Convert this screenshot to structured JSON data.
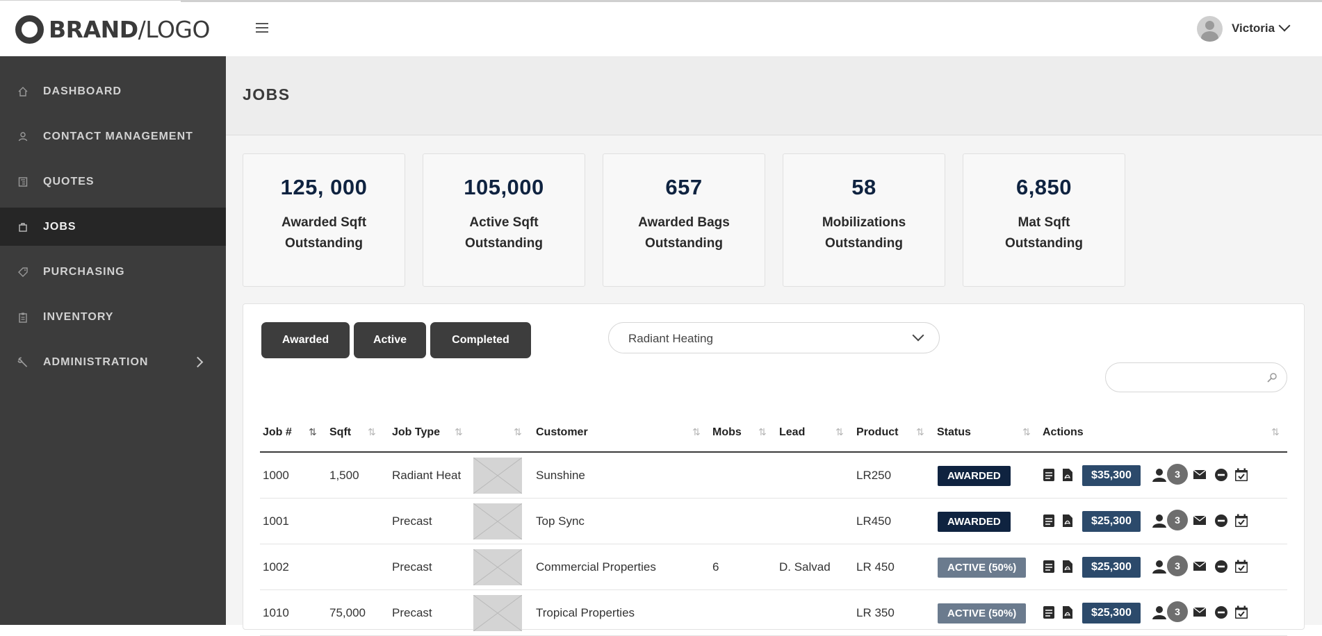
{
  "header": {
    "logo_bold": "BRAND",
    "logo_light": "/LOGO",
    "user_name": "Victoria"
  },
  "sidebar": {
    "items": [
      {
        "label": "DASHBOARD",
        "icon": "home-icon"
      },
      {
        "label": "CONTACT MANAGEMENT",
        "icon": "user-icon"
      },
      {
        "label": "QUOTES",
        "icon": "quotes-icon"
      },
      {
        "label": "JOBS",
        "icon": "bag-icon"
      },
      {
        "label": "PURCHASING",
        "icon": "tag-icon"
      },
      {
        "label": "INVENTORY",
        "icon": "clipboard-icon"
      },
      {
        "label": "ADMINISTRATION",
        "icon": "wrench-icon"
      }
    ]
  },
  "page": {
    "title": "JOBS"
  },
  "stats": [
    {
      "value": "125, 000",
      "label_line1": "Awarded Sqft",
      "label_line2": "Outstanding"
    },
    {
      "value": "105,000",
      "label_line1": "Active Sqft",
      "label_line2": "Outstanding"
    },
    {
      "value": "657",
      "label_line1": "Awarded Bags",
      "label_line2": "Outstanding"
    },
    {
      "value": "58",
      "label_line1": "Mobilizations",
      "label_line2": "Outstanding"
    },
    {
      "value": "6,850",
      "label_line1": "Mat Sqft",
      "label_line2": "Outstanding"
    }
  ],
  "filters": {
    "tabs": [
      "Awarded",
      "Active",
      "Completed"
    ],
    "select_value": "Radiant Heating",
    "search_placeholder": ""
  },
  "table": {
    "headers": [
      "Job #",
      "Sqft",
      "Job Type",
      "Customer",
      "Mobs",
      "Lead",
      "Product",
      "Status",
      "Actions"
    ],
    "rows": [
      {
        "job": "1000",
        "sqft": "1,500",
        "type": "Radiant Heat",
        "customer": "Sunshine",
        "mobs": "",
        "lead": "",
        "product": "LR250",
        "status": "AWARDED",
        "price": "$35,300",
        "count": "3"
      },
      {
        "job": "1001",
        "sqft": "",
        "type": "Precast",
        "customer": "Top Sync",
        "mobs": "",
        "lead": "",
        "product": "LR450",
        "status": "AWARDED",
        "price": "$25,300",
        "count": "3"
      },
      {
        "job": "1002",
        "sqft": "",
        "type": "Precast",
        "customer": "Commercial Properties",
        "mobs": "6",
        "lead": "D. Salvad",
        "product": "LR 450",
        "status": "ACTIVE (50%)",
        "price": "$25,300",
        "count": "3"
      },
      {
        "job": "1010",
        "sqft": "75,000",
        "type": "Precast",
        "customer": "Tropical Properties",
        "mobs": "",
        "lead": "",
        "product": "LR 350",
        "status": "ACTIVE (50%)",
        "price": "$25,300",
        "count": "3"
      }
    ]
  },
  "colors": {
    "sidebar_bg": "#3c3c3c",
    "sidebar_active": "#262626",
    "navy": "#0f2340",
    "status_active": "#6b7b8e",
    "price_bg": "#2c4a6b"
  }
}
